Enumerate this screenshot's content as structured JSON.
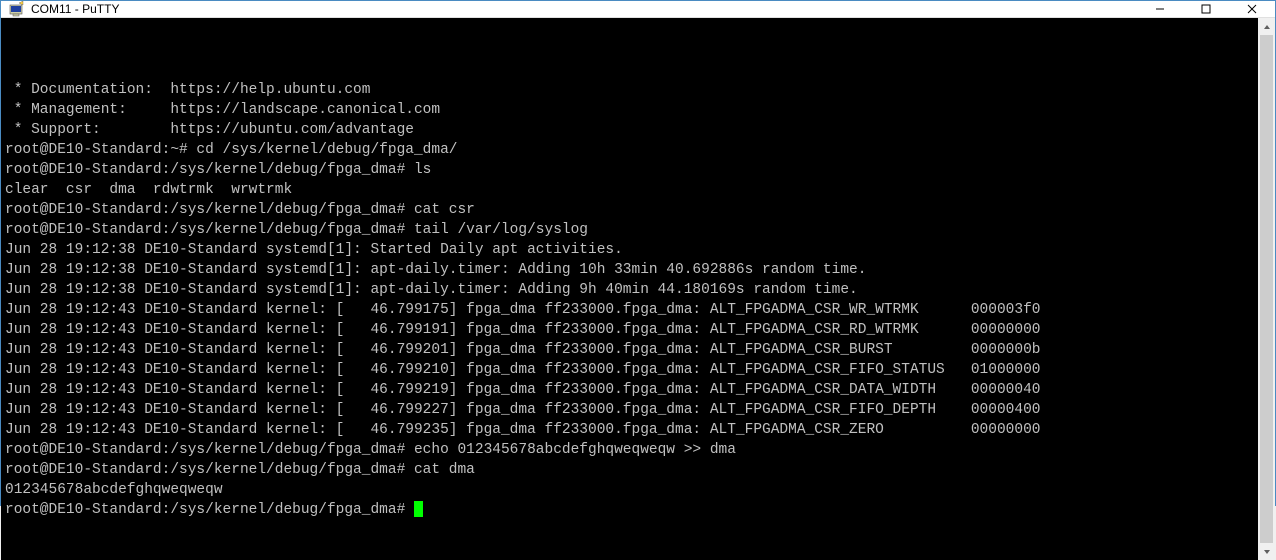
{
  "window": {
    "title": "COM11 - PuTTY"
  },
  "terminal": {
    "lines": [
      "",
      " * Documentation:  https://help.ubuntu.com",
      " * Management:     https://landscape.canonical.com",
      " * Support:        https://ubuntu.com/advantage",
      "root@DE10-Standard:~# cd /sys/kernel/debug/fpga_dma/",
      "root@DE10-Standard:/sys/kernel/debug/fpga_dma# ls",
      "clear  csr  dma  rdwtrmk  wrwtrmk",
      "root@DE10-Standard:/sys/kernel/debug/fpga_dma# cat csr",
      "root@DE10-Standard:/sys/kernel/debug/fpga_dma# tail /var/log/syslog",
      "Jun 28 19:12:38 DE10-Standard systemd[1]: Started Daily apt activities.",
      "Jun 28 19:12:38 DE10-Standard systemd[1]: apt-daily.timer: Adding 10h 33min 40.692886s random time.",
      "Jun 28 19:12:38 DE10-Standard systemd[1]: apt-daily.timer: Adding 9h 40min 44.180169s random time.",
      "Jun 28 19:12:43 DE10-Standard kernel: [   46.799175] fpga_dma ff233000.fpga_dma: ALT_FPGADMA_CSR_WR_WTRMK      000003f0",
      "Jun 28 19:12:43 DE10-Standard kernel: [   46.799191] fpga_dma ff233000.fpga_dma: ALT_FPGADMA_CSR_RD_WTRMK      00000000",
      "Jun 28 19:12:43 DE10-Standard kernel: [   46.799201] fpga_dma ff233000.fpga_dma: ALT_FPGADMA_CSR_BURST         0000000b",
      "Jun 28 19:12:43 DE10-Standard kernel: [   46.799210] fpga_dma ff233000.fpga_dma: ALT_FPGADMA_CSR_FIFO_STATUS   01000000",
      "Jun 28 19:12:43 DE10-Standard kernel: [   46.799219] fpga_dma ff233000.fpga_dma: ALT_FPGADMA_CSR_DATA_WIDTH    00000040",
      "Jun 28 19:12:43 DE10-Standard kernel: [   46.799227] fpga_dma ff233000.fpga_dma: ALT_FPGADMA_CSR_FIFO_DEPTH    00000400",
      "Jun 28 19:12:43 DE10-Standard kernel: [   46.799235] fpga_dma ff233000.fpga_dma: ALT_FPGADMA_CSR_ZERO          00000000",
      "root@DE10-Standard:/sys/kernel/debug/fpga_dma# echo 012345678abcdefghqweqweqw >> dma",
      "root@DE10-Standard:/sys/kernel/debug/fpga_dma# cat dma",
      "012345678abcdefghqweqweqw"
    ],
    "prompt": "root@DE10-Standard:/sys/kernel/debug/fpga_dma# "
  }
}
